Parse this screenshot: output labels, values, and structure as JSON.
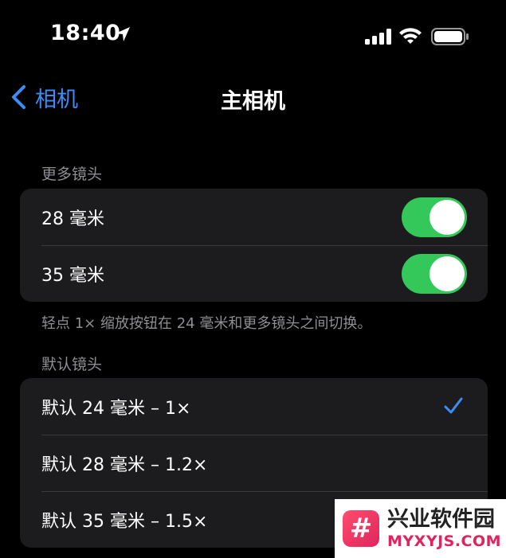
{
  "status_bar": {
    "time": "18:40",
    "icons": [
      "location-arrow-icon",
      "cellular-signal-icon",
      "wifi-icon",
      "battery-icon"
    ]
  },
  "nav": {
    "back_label": "相机",
    "title": "主相机"
  },
  "more_lenses": {
    "header": "更多镜头",
    "items": [
      {
        "label": "28 毫米",
        "enabled": true
      },
      {
        "label": "35 毫米",
        "enabled": true
      }
    ],
    "footer": "轻点 1× 缩放按钮在 24 毫米和更多镜头之间切换。"
  },
  "default_lens": {
    "header": "默认镜头",
    "items": [
      {
        "label": "默认 24 毫米 – 1×",
        "selected": true
      },
      {
        "label": "默认 28 毫米 – 1.2×",
        "selected": false
      },
      {
        "label": "默认 35 毫米 – 1.5×",
        "selected": false
      }
    ]
  },
  "watermark": {
    "logo_glyph": "#",
    "name": "兴业软件园",
    "url": "MYXYJS.COM"
  },
  "colors": {
    "background": "#000000",
    "group_background": "#1c1c1e",
    "accent_blue": "#3e8df7",
    "toggle_on": "#34c759",
    "secondary_text": "#8e8e93"
  }
}
